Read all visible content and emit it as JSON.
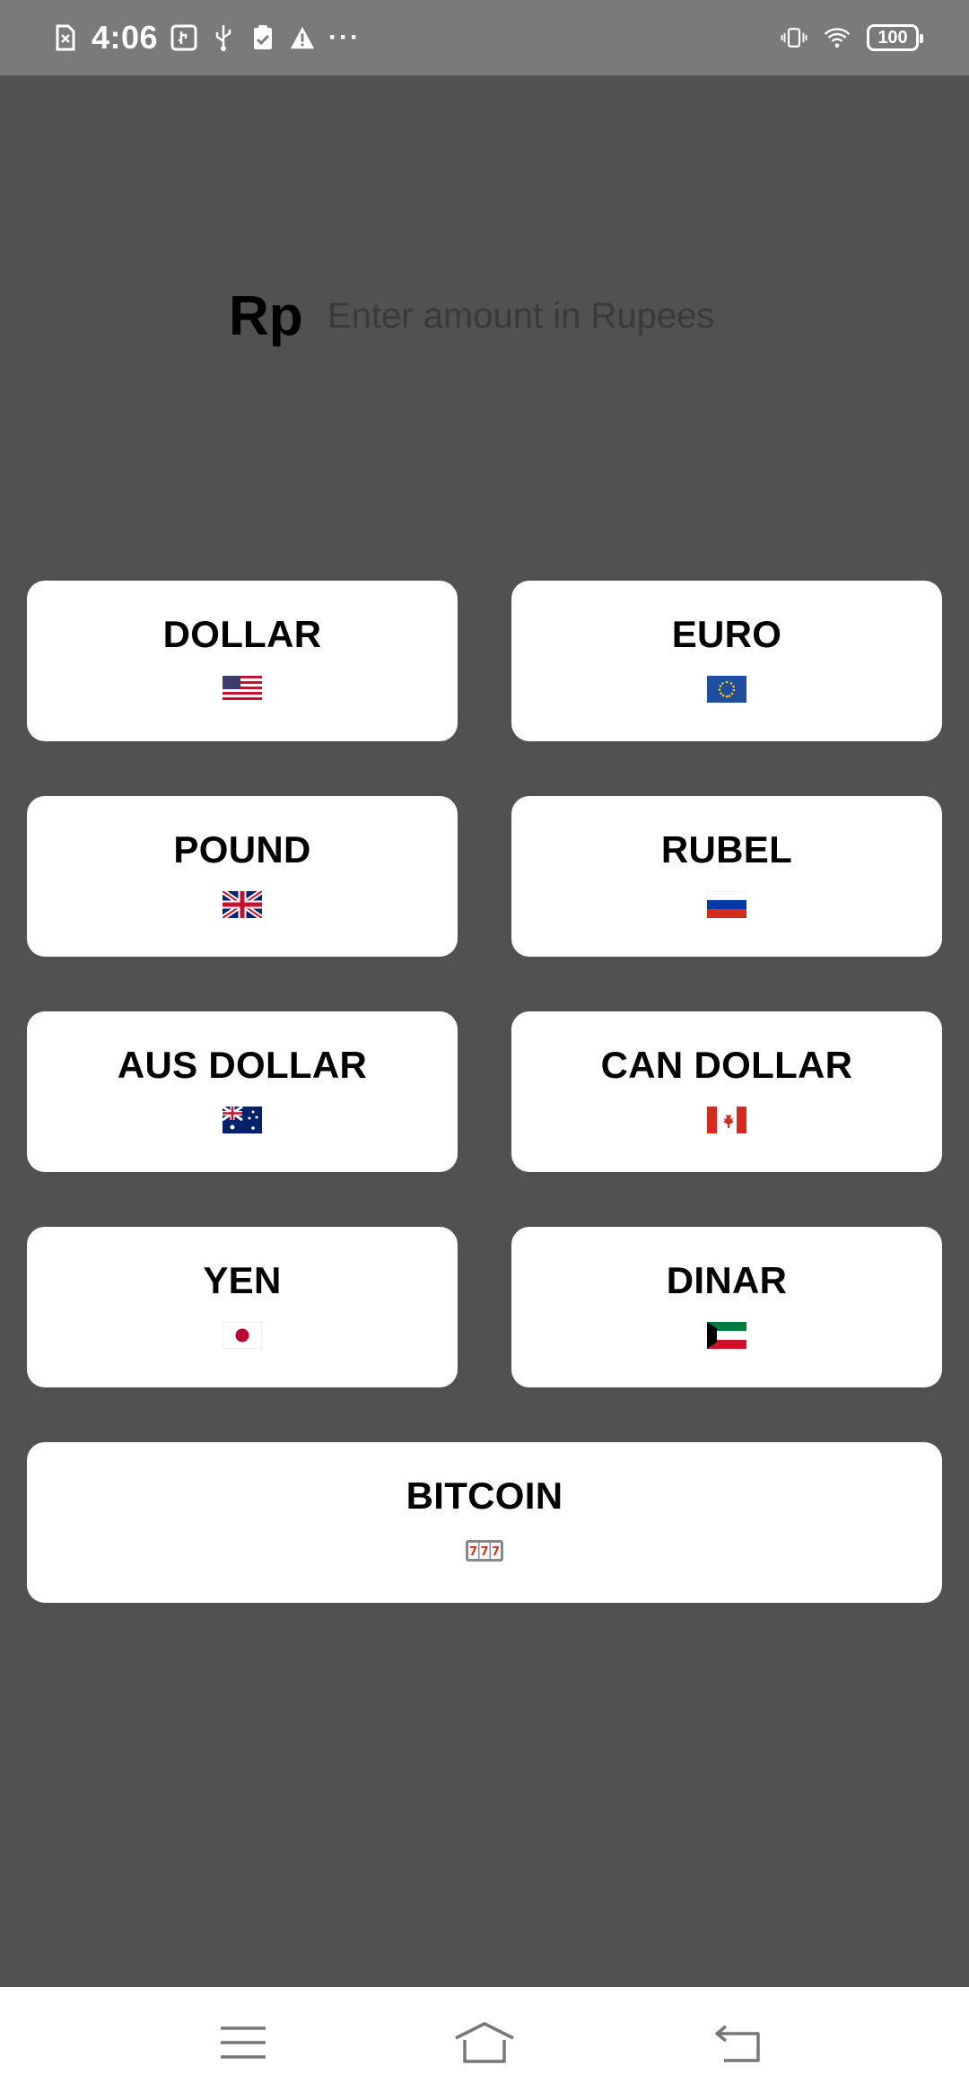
{
  "status_bar": {
    "time": "4:06",
    "battery": "100",
    "more": "···",
    "left_icons": [
      "sim-error-icon",
      "usb-debug-icon",
      "usb-icon",
      "clipboard-check-icon",
      "warning-icon"
    ],
    "right_icons": [
      "vibrate-icon",
      "wifi-icon",
      "battery-icon"
    ]
  },
  "converter": {
    "symbol": "Rp",
    "placeholder": "Enter amount in Rupees"
  },
  "currencies": [
    {
      "label": "DOLLAR",
      "flag": "us-flag-icon"
    },
    {
      "label": "EURO",
      "flag": "eu-flag-icon"
    },
    {
      "label": "POUND",
      "flag": "uk-flag-icon"
    },
    {
      "label": "RUBEL",
      "flag": "russia-flag-icon"
    },
    {
      "label": "AUS DOLLAR",
      "flag": "australia-flag-icon"
    },
    {
      "label": "CAN DOLLAR",
      "flag": "canada-flag-icon"
    },
    {
      "label": "YEN",
      "flag": "japan-flag-icon"
    },
    {
      "label": "DINAR",
      "flag": "kuwait-flag-icon"
    },
    {
      "label": "BITCOIN",
      "flag": "slot-machine-icon"
    }
  ],
  "colors": {
    "background": "#515151",
    "status_bar": "#7a7a7a",
    "button": "#ffffff",
    "nav_bar": "#ffffff"
  },
  "nav": [
    "menu-icon",
    "home-icon",
    "back-icon"
  ]
}
